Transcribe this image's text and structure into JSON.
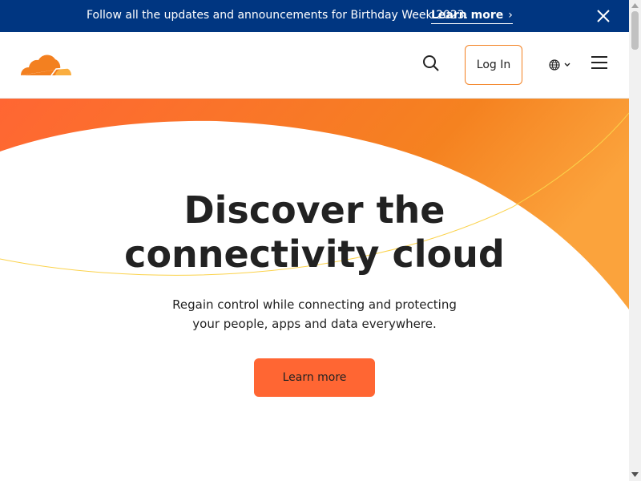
{
  "announcement": {
    "text": "Follow all the updates and announcements for Birthday Week 2023.",
    "link_label": "Learn more",
    "link_chevron": "›"
  },
  "header": {
    "logo_icon": "cloudflare-cloud-logo",
    "search_icon": "search-icon",
    "login_label": "Log In",
    "language_icon": "globe-icon",
    "menu_icon": "hamburger-menu-icon"
  },
  "hero": {
    "title_line1": "Discover the",
    "title_line2": "connectivity cloud",
    "subtitle_line1": "Regain control while connecting and protecting",
    "subtitle_line2": "your people, apps and data everywhere.",
    "cta_label": "Learn more"
  },
  "colors": {
    "banner": "#003681",
    "accent": "#f38020",
    "cta": "#ff6633"
  }
}
